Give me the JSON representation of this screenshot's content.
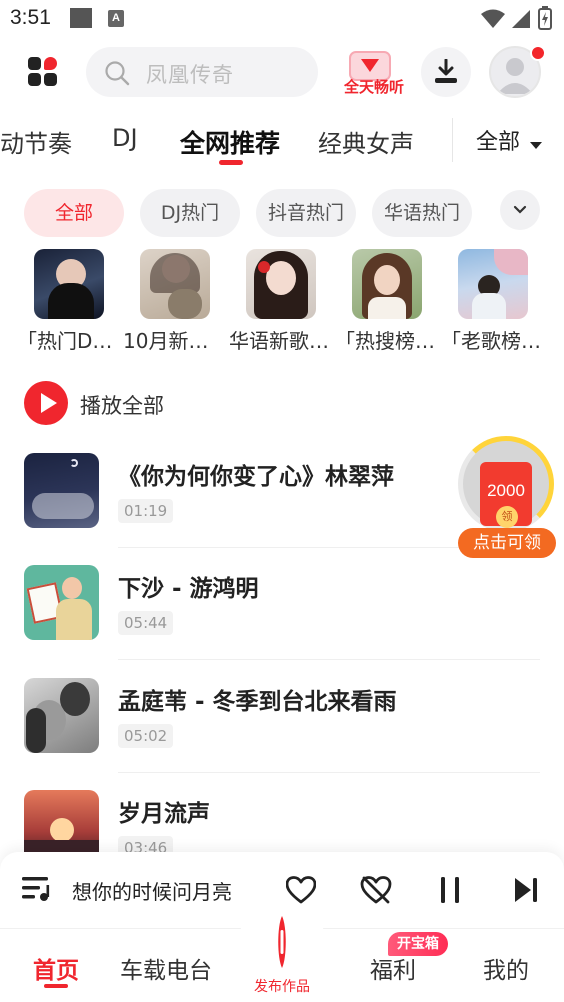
{
  "status_bar": {
    "time": "3:51",
    "a_icon": "A"
  },
  "header": {
    "search_placeholder": "凤凰传奇",
    "promo_label": "全天畅听"
  },
  "tabs": [
    {
      "label": "动节奏"
    },
    {
      "label": "DJ"
    },
    {
      "label": "全网推荐",
      "active": true
    },
    {
      "label": "经典女声"
    }
  ],
  "tab_all_label": "全部",
  "chips": [
    {
      "label": "全部",
      "active": true
    },
    {
      "label": "DJ热门"
    },
    {
      "label": "抖音热门"
    },
    {
      "label": "华语热门"
    }
  ],
  "playlists": [
    {
      "title": "「热门D…"
    },
    {
      "title": "10月新歌…"
    },
    {
      "title": "华语新歌…"
    },
    {
      "title": "「热搜榜…"
    },
    {
      "title": "「老歌榜…"
    }
  ],
  "play_all_label": "播放全部",
  "songs": [
    {
      "title": "《你为何你变了心》林翠萍",
      "duration": "01:19"
    },
    {
      "title": "下沙 - 游鸿明",
      "duration": "05:44"
    },
    {
      "title": "孟庭苇 - 冬季到台北来看雨",
      "duration": "05:02"
    },
    {
      "title": "岁月流声",
      "duration": "03:46"
    }
  ],
  "reward": {
    "amount": "2000",
    "coin_label": "领",
    "button_label": "点击可领"
  },
  "player": {
    "now_playing": "想你的时候问月亮"
  },
  "bottom_nav": {
    "home": "首页",
    "radio": "车载电台",
    "publish": "发布作品",
    "welfare": "福利",
    "welfare_badge": "开宝箱",
    "mine": "我的"
  },
  "colors": {
    "accent": "#f0262e",
    "reward_button": "#f36a21"
  }
}
